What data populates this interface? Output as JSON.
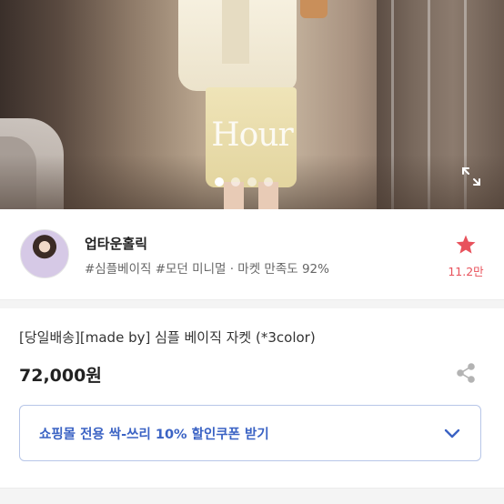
{
  "hero": {
    "watermark": "Hour",
    "slides": 4,
    "active_slide": 1,
    "expand_icon": "expand-icon"
  },
  "store": {
    "name": "업타운홀릭",
    "tags": "#심플베이직 #모던 미니멀 · 마켓 만족도 92%",
    "favorite_count": "11.2만",
    "favorite_icon": "star-icon",
    "favorite_color": "#e8525c"
  },
  "product": {
    "title": "[당일배송][made by] 심플 베이직 자켓 (*3color)",
    "price": "72,000원",
    "share_icon": "share-icon"
  },
  "coupon": {
    "label": "쇼핑몰 전용 싹-쓰리 10% 할인쿠폰 받기",
    "icon": "chevron-down-icon",
    "accent_color": "#3b63c4"
  }
}
